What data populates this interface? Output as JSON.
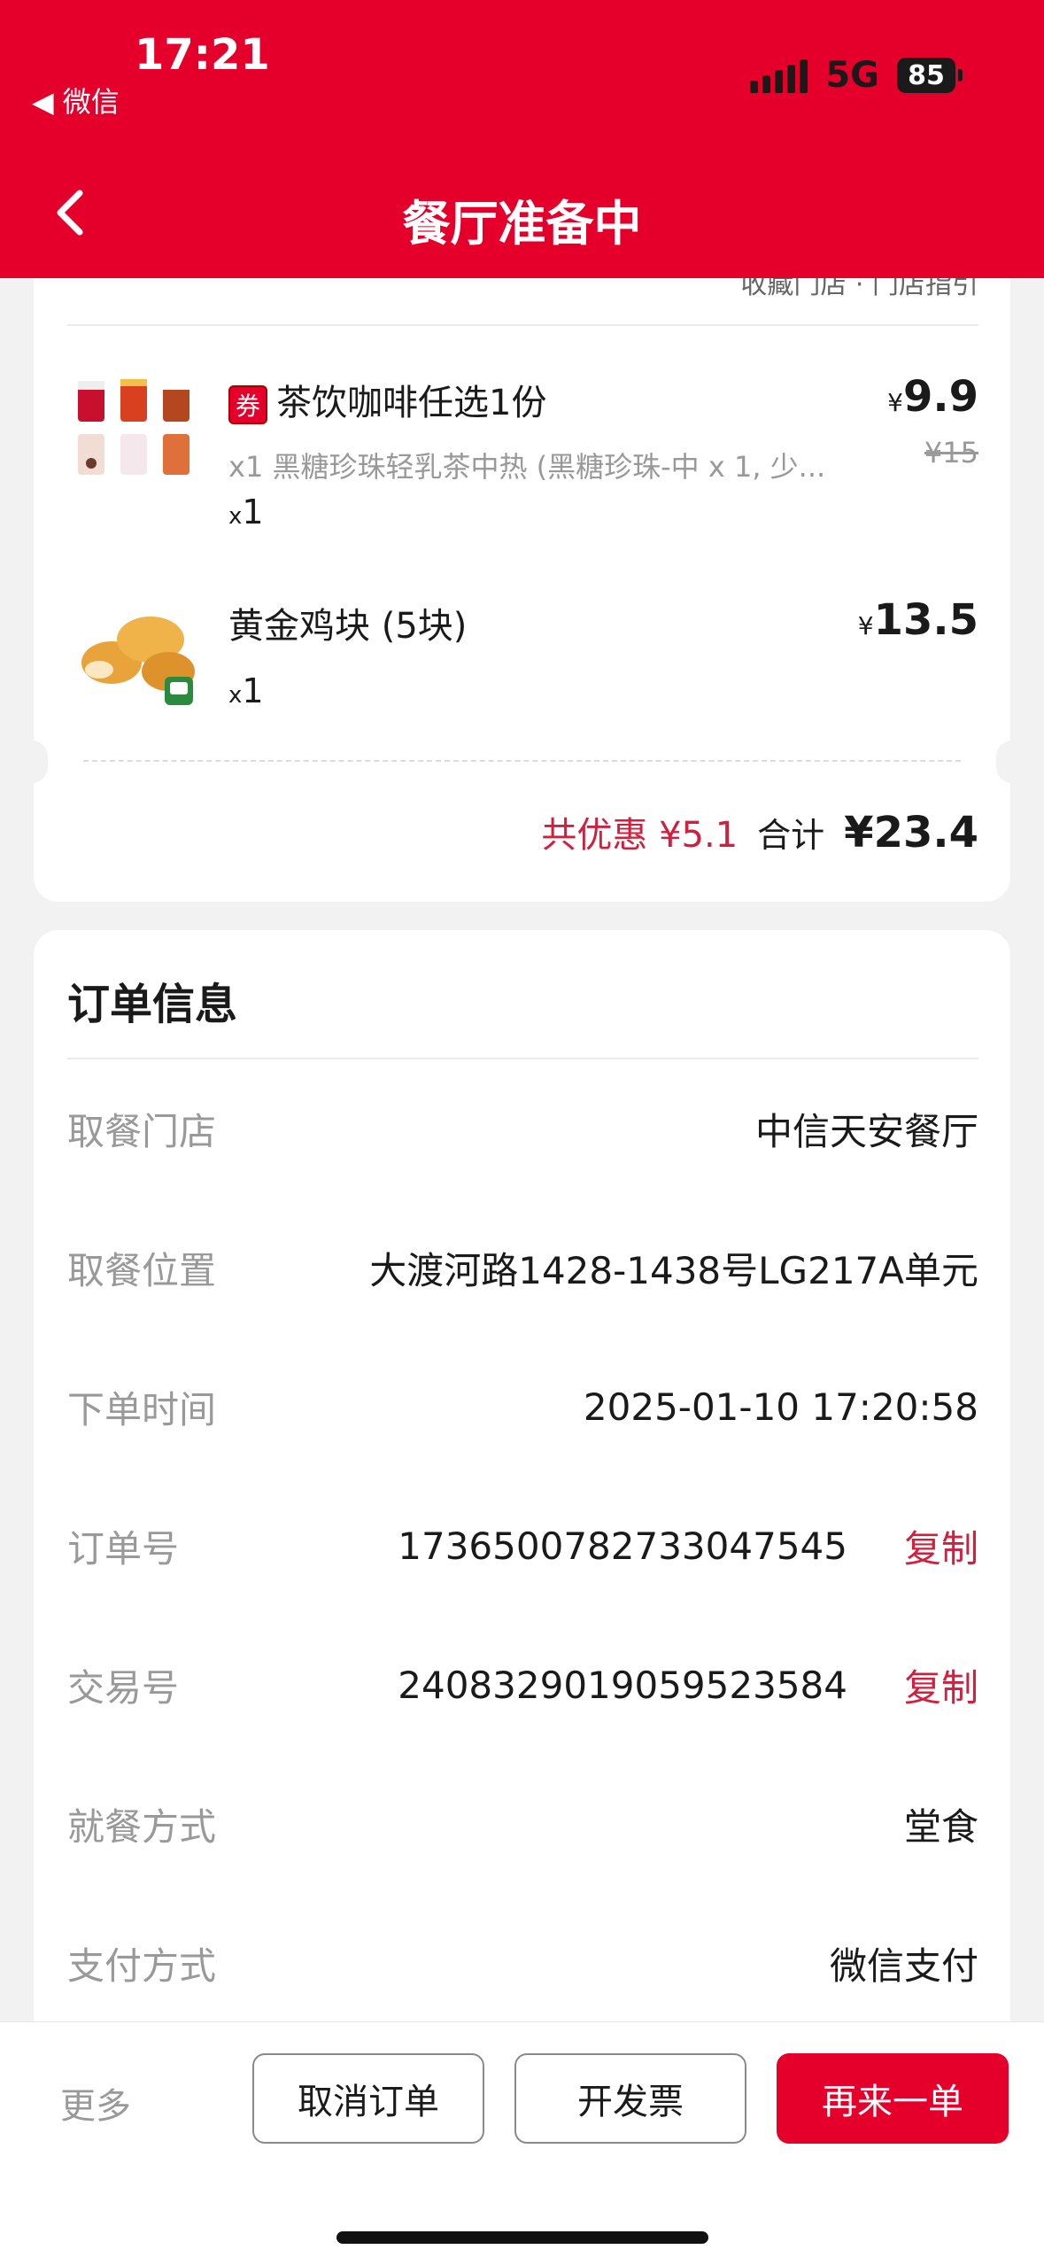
{
  "status_bar": {
    "time": "17:21",
    "back_app": "◀ 微信",
    "network": "5G",
    "battery": "85"
  },
  "header": {
    "title": "餐厅准备中"
  },
  "card1": {
    "peek_text": "收藏门店 · 门店指引",
    "items": [
      {
        "coupon_badge": "券",
        "name": "茶饮咖啡任选1份",
        "desc": "x1 黑糖珍珠轻乳茶中热 (黑糖珍珠-中 x 1, 少...",
        "qty_prefix": "x",
        "qty": "1",
        "currency": "¥",
        "price": "9.9",
        "original_price": "¥15"
      },
      {
        "name": "黄金鸡块 (5块)",
        "qty_prefix": "x",
        "qty": "1",
        "currency": "¥",
        "price": "13.5"
      }
    ],
    "discount_text": "共优惠 ¥5.1",
    "total_label": "合计",
    "total_value": "¥23.4"
  },
  "order_info": {
    "title": "订单信息",
    "rows": [
      {
        "label": "取餐门店",
        "value": "中信天安餐厅"
      },
      {
        "label": "取餐位置",
        "value": "大渡河路1428-1438号LG217A单元"
      },
      {
        "label": "下单时间",
        "value": "2025-01-10 17:20:58"
      },
      {
        "label": "订单号",
        "value": "1736500782733047545",
        "action": "复制"
      },
      {
        "label": "交易号",
        "value": "2408329019059523584",
        "action": "复制"
      },
      {
        "label": "就餐方式",
        "value": "堂食"
      },
      {
        "label": "支付方式",
        "value": "微信支付"
      }
    ]
  },
  "bottom_bar": {
    "more": "更多",
    "cancel": "取消订单",
    "invoice": "开发票",
    "reorder": "再来一单"
  },
  "colors": {
    "brand_red": "#e4002b",
    "discount_red": "#d11f3e"
  }
}
